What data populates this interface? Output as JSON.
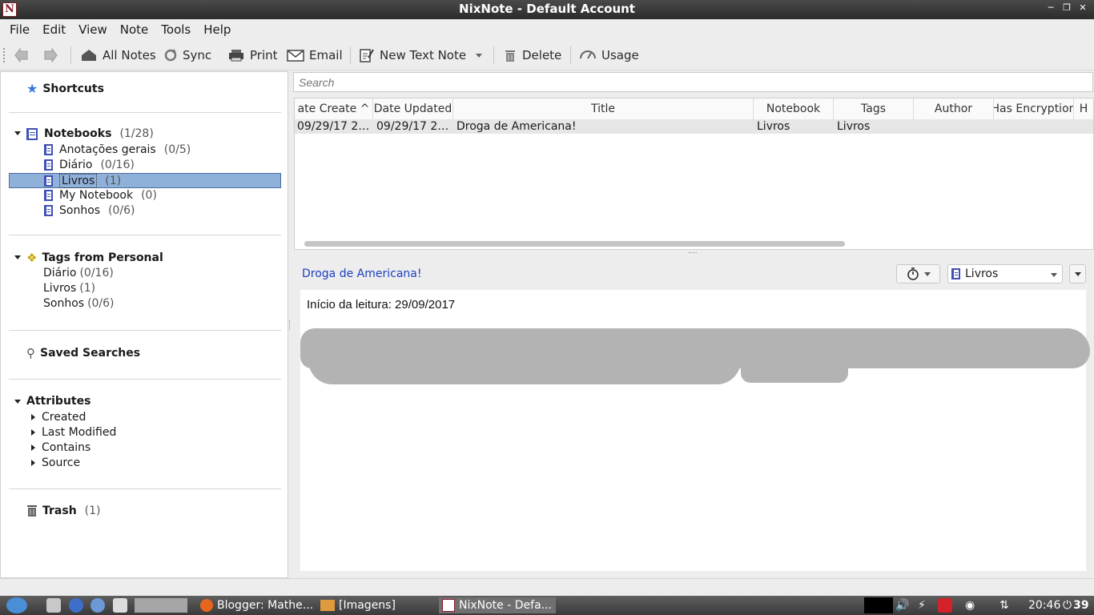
{
  "window": {
    "title": "NixNote - Default Account",
    "app_icon_letter": "N"
  },
  "menu": [
    "File",
    "Edit",
    "View",
    "Note",
    "Tools",
    "Help"
  ],
  "toolbar": {
    "all_notes": "All Notes",
    "sync": "Sync",
    "print": "Print",
    "email": "Email",
    "new_text_note": "New Text Note",
    "delete": "Delete",
    "usage": "Usage"
  },
  "sidebar": {
    "shortcuts": "Shortcuts",
    "notebooks": {
      "label": "Notebooks",
      "count": "(1/28)"
    },
    "notebook_items": [
      {
        "label": "Anotações gerais",
        "count": "(0/5)"
      },
      {
        "label": "Diário",
        "count": "(0/16)"
      },
      {
        "label": "Livros",
        "count": "(1)"
      },
      {
        "label": "My Notebook",
        "count": "(0)"
      },
      {
        "label": "Sonhos",
        "count": "(0/6)"
      }
    ],
    "tags": {
      "label": "Tags from Personal"
    },
    "tag_items": [
      {
        "label": "Diário",
        "count": "(0/16)"
      },
      {
        "label": "Livros",
        "count": "(1)"
      },
      {
        "label": "Sonhos",
        "count": "(0/6)"
      }
    ],
    "saved_searches": "Saved Searches",
    "attributes": "Attributes",
    "attribute_items": [
      "Created",
      "Last Modified",
      "Contains",
      "Source"
    ],
    "trash": {
      "label": "Trash",
      "count": "(1)"
    }
  },
  "search": {
    "placeholder": "Search"
  },
  "notelist": {
    "columns": [
      "ate Create ^",
      "Date Updated",
      "Title",
      "Notebook",
      "Tags",
      "Author",
      "Has Encryption",
      "H"
    ],
    "rows": [
      {
        "created": "09/29/17 2…",
        "updated": "09/29/17 2…",
        "title": "Droga de Americana!",
        "notebook": "Livros",
        "tags": "Livros",
        "author": "",
        "encryption": ""
      }
    ]
  },
  "note": {
    "title": "Droga de Americana!",
    "notebook": "Livros",
    "body_line1": "Início da leitura: 29/09/2017"
  },
  "taskbar": {
    "tasks": [
      "Blogger: Mathe...",
      "[Imagens]",
      "NixNote - Defa..."
    ],
    "time": "20:46",
    "battery": "39"
  },
  "colors": {
    "selection": "#8fb0d9",
    "note_title_link": "#1a3fc1",
    "notebook_icon": "#3f51b5"
  }
}
